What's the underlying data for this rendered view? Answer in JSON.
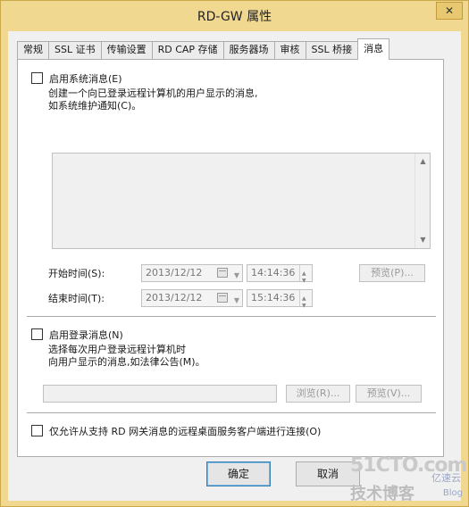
{
  "window": {
    "title": "RD-GW 属性",
    "close_glyph": "✕"
  },
  "tabs": [
    {
      "label": "常规"
    },
    {
      "label": "SSL 证书"
    },
    {
      "label": "传输设置"
    },
    {
      "label": "RD CAP 存储"
    },
    {
      "label": "服务器场"
    },
    {
      "label": "审核"
    },
    {
      "label": "SSL 桥接"
    },
    {
      "label": "消息"
    }
  ],
  "system_message": {
    "checkbox_label": "启用系统消息(E)",
    "description_line1": "创建一个向已登录远程计算机的用户显示的消息,",
    "description_line2": "如系统维护通知(C)。",
    "start_label": "开始时间(S):",
    "start_date": "2013/12/12",
    "start_time": "14:14:36",
    "end_label": "结束时间(T):",
    "end_date": "2013/12/12",
    "end_time": "15:14:36",
    "preview_button": "预览(P)..."
  },
  "logon_message": {
    "checkbox_label": "启用登录消息(N)",
    "description_line1": "选择每次用户登录远程计算机时",
    "description_line2": "向用户显示的消息,如法律公告(M)。",
    "browse_button": "浏览(R)...",
    "preview_button": "预览(V)..."
  },
  "only_allow": {
    "checkbox_label": "仅允许从支持 RD 网关消息的远程桌面服务客户端进行连接(O)"
  },
  "footer": {
    "ok_label": "确定",
    "cancel_label": "取消"
  },
  "watermark": {
    "line1": "51CTO.com",
    "line2": "技术博客",
    "line3": "Blog",
    "line4": "亿速云"
  }
}
